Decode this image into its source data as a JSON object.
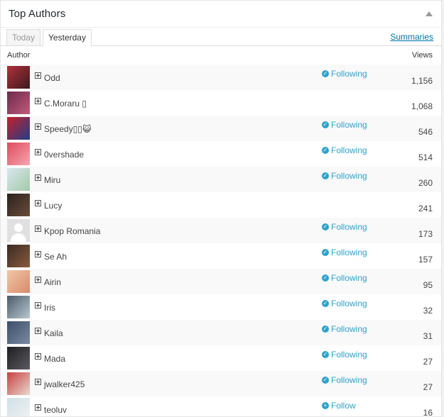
{
  "header": {
    "title": "Top Authors"
  },
  "tabs": [
    {
      "label": "Today",
      "active": false
    },
    {
      "label": "Yesterday",
      "active": true
    }
  ],
  "summaries_label": "Summaries",
  "columns": {
    "author": "Author",
    "views": "Views"
  },
  "rows": [
    {
      "name": "Odd",
      "follow": "Following",
      "views": "1,156",
      "avatar": "photo"
    },
    {
      "name": "C.Moraru ▯",
      "follow": "",
      "views": "1,068",
      "avatar": "photo"
    },
    {
      "name": "Speedy▯▯😺",
      "follow": "Following",
      "views": "546",
      "avatar": "photo"
    },
    {
      "name": "0vershade",
      "follow": "Following",
      "views": "514",
      "avatar": "photo"
    },
    {
      "name": "Miru",
      "follow": "Following",
      "views": "260",
      "avatar": "photo"
    },
    {
      "name": "Lucy",
      "follow": "",
      "views": "241",
      "avatar": "photo"
    },
    {
      "name": "Kpop Romania",
      "follow": "Following",
      "views": "173",
      "avatar": "default"
    },
    {
      "name": "Se Ah",
      "follow": "Following",
      "views": "157",
      "avatar": "photo"
    },
    {
      "name": "Airin",
      "follow": "Following",
      "views": "95",
      "avatar": "photo"
    },
    {
      "name": "Iris",
      "follow": "Following",
      "views": "32",
      "avatar": "photo"
    },
    {
      "name": "Kaila",
      "follow": "Following",
      "views": "31",
      "avatar": "photo"
    },
    {
      "name": "Mada",
      "follow": "Following",
      "views": "27",
      "avatar": "photo"
    },
    {
      "name": "jwalker425",
      "follow": "Following",
      "views": "27",
      "avatar": "photo"
    },
    {
      "name": "teoluv",
      "follow": "Follow",
      "views": "16",
      "avatar": "photo"
    }
  ],
  "icons": {
    "following": "check-circle-icon",
    "follow": "plus-circle-icon",
    "expand": "plus-square-icon",
    "collapse": "triangle-up-icon"
  },
  "colors": {
    "link": "#0073aa",
    "follow": "#2ea2cc",
    "alt_row": "#f9f9f9"
  }
}
